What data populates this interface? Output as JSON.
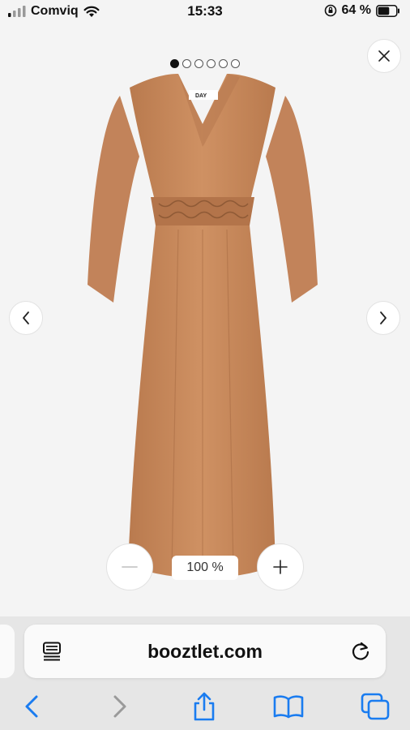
{
  "status_bar": {
    "carrier": "Comviq",
    "time": "15:33",
    "battery_percent": "64 %",
    "battery_level": 0.64
  },
  "viewer": {
    "image_count": 6,
    "active_index": 0,
    "zoom_level": "100 %",
    "product_image_label": "DAY",
    "dress_color": "#c98a5c"
  },
  "browser": {
    "url": "booztlet.com",
    "accent_color": "#1a7cf0"
  },
  "icons": {
    "close": "close-icon",
    "prev": "chevron-left-icon",
    "next": "chevron-right-icon",
    "zoom_out": "minus-icon",
    "zoom_in": "plus-icon",
    "reader": "reader-mode-icon",
    "reload": "reload-icon",
    "back": "back-icon",
    "forward": "forward-icon",
    "share": "share-icon",
    "bookmarks": "bookmarks-icon",
    "tabs": "tabs-icon"
  }
}
